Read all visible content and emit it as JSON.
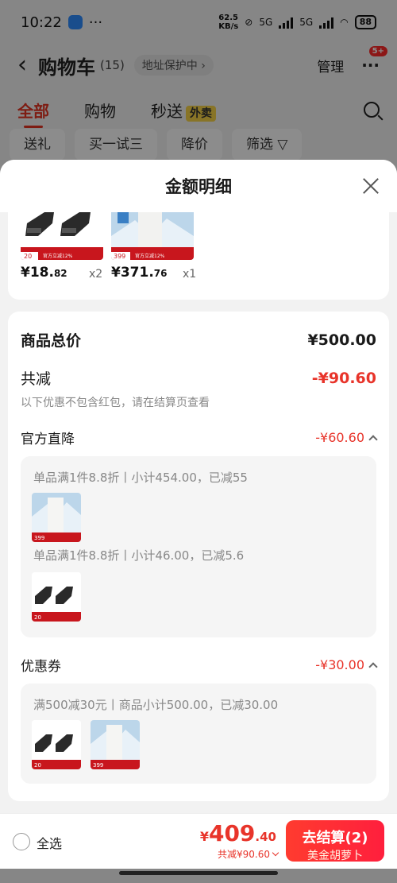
{
  "status_bar": {
    "time": "10:22",
    "more": "···",
    "net_speed_top": "62.5",
    "net_speed_unit": "KB/s",
    "signal1": "5G",
    "signal2": "5G",
    "battery": "88"
  },
  "header": {
    "title": "购物车",
    "count": "(15)",
    "address": "地址保护中",
    "manage": "管理",
    "badge": "5+"
  },
  "tabs": {
    "all": "全部",
    "shopping": "购物",
    "flash": "秒送",
    "flash_tag": "外卖"
  },
  "chips": [
    "送礼",
    "买一试三",
    "降价",
    "筛选"
  ],
  "sheet": {
    "title": "金额明细",
    "items": [
      {
        "price_int": "¥18.",
        "price_dec": "82",
        "qty": "x2",
        "tag": "20",
        "promo": "官方立减12%"
      },
      {
        "price_int": "¥371.",
        "price_dec": "76",
        "qty": "x1",
        "tag": "399",
        "promo": "官方立减12%"
      }
    ],
    "total_label": "商品总价",
    "total_value": "¥500.00",
    "reduce_label": "共减",
    "reduce_value": "-¥90.60",
    "note": "以下优惠不包含红包，请在结算页查看",
    "official_label": "官方直降",
    "official_value": "-¥60.60",
    "official_rules": [
      "单品满1件8.8折丨小计454.00，已减55",
      "单品满1件8.8折丨小计46.00，已减5.6"
    ],
    "coupon_label": "优惠券",
    "coupon_value": "-¥30.00",
    "coupon_rule": "满500减30元丨商品小计500.00，已减30.00",
    "thumb_tags": {
      "jacket": "399",
      "socks": "20"
    }
  },
  "bottom": {
    "select_all": "全选",
    "yen": "¥",
    "total_int": "409",
    "total_dec": ".40",
    "saved": "共减¥90.60",
    "checkout": "去结算(2)",
    "checkout_sub": "美金胡萝卜"
  },
  "colors": {
    "accent": "#e8342a",
    "tab_active": "#e63322",
    "waimai": "#f7d348"
  }
}
